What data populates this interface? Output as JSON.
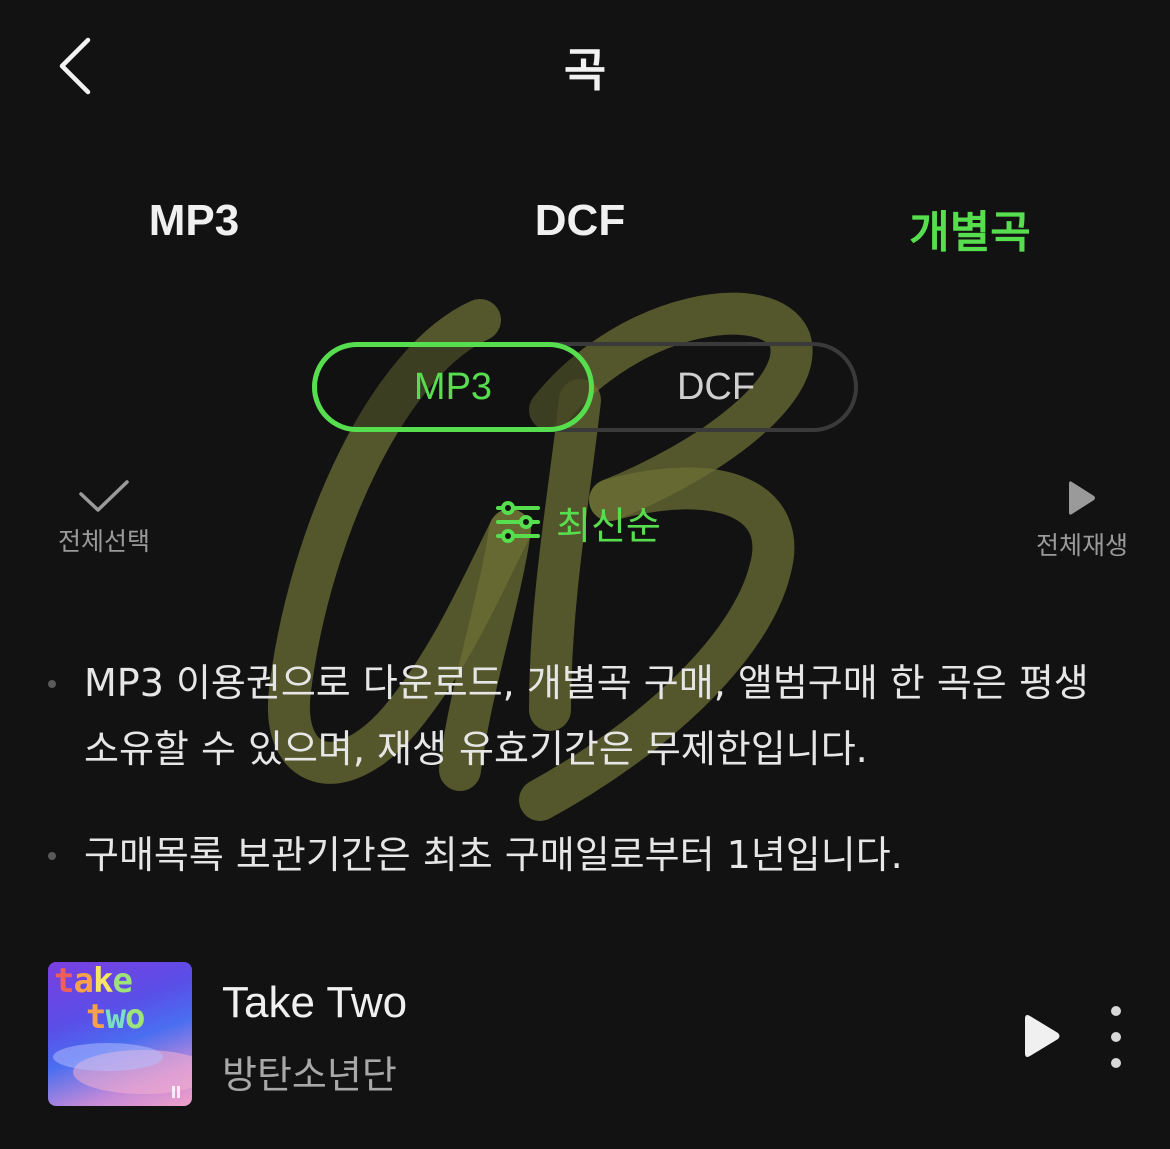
{
  "header": {
    "title": "곡"
  },
  "top_tabs": [
    {
      "label": "MP3",
      "active": false
    },
    {
      "label": "DCF",
      "active": false
    },
    {
      "label": "개별곡",
      "active": true
    }
  ],
  "segment": {
    "options": [
      "MP3",
      "DCF"
    ],
    "selected": "MP3"
  },
  "toolbar": {
    "select_all_label": "전체선택",
    "sort_label": "최신순",
    "play_all_label": "전체재생"
  },
  "notices": [
    "MP3 이용권으로 다운로드, 개별곡 구매, 앨범구매 한 곡은 평생 소유할 수 있으며, 재생 유효기간은 무제한입니다.",
    "구매목록 보관기간은 최초 구매일로부터 1년입니다."
  ],
  "track": {
    "title": "Take Two",
    "artist": "방탄소년단",
    "album_art_text": [
      "take",
      "two"
    ]
  },
  "colors": {
    "accent": "#57de4e",
    "background": "#121212"
  },
  "icons": [
    "back-icon",
    "check-icon",
    "sort-sliders-icon",
    "play-icon",
    "more-vertical-icon"
  ]
}
